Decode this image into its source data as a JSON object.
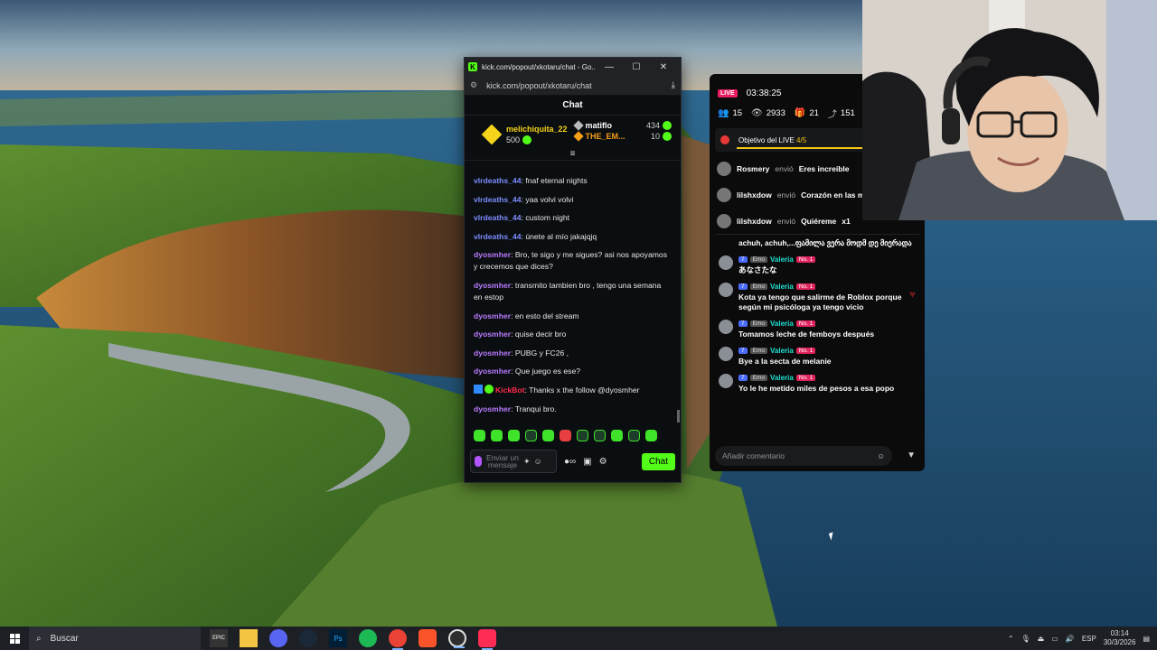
{
  "browser": {
    "window_title": "kick.com/popout/xkotaru/chat - Go...",
    "url": "kick.com/popout/xkotaru/chat",
    "chat_header": "Chat"
  },
  "kick_chat": {
    "pinned_top": {
      "name": "melichiquita_22",
      "value": "500"
    },
    "top_supporters": [
      {
        "name": "matiflo",
        "value": "434",
        "color": "#ffffff"
      },
      {
        "name": "THE_EM...",
        "value": "10",
        "color": "#f59e18"
      }
    ],
    "messages": [
      {
        "user": "vlrdeaths_44",
        "text": ": fnaf eternal nights",
        "color": "blue"
      },
      {
        "user": "vlrdeaths_44",
        "text": ": yaa volvi volvi",
        "color": "blue"
      },
      {
        "user": "vlrdeaths_44",
        "text": ": custom night",
        "color": "blue"
      },
      {
        "user": "vlrdeaths_44",
        "text": ": únete al mío jakajqjq",
        "color": "blue"
      },
      {
        "user": "dyosmher",
        "text": ": Bro, te sigo y me sigues? asi nos apoyamos y crecemos que dices?",
        "color": "purple"
      },
      {
        "user": "dyosmher",
        "text": ": transmito tambien bro , tengo una semana en estop",
        "color": "purple"
      },
      {
        "user": "dyosmher",
        "text": ": en esto del stream",
        "color": "purple"
      },
      {
        "user": "dyosmher",
        "text": ": quise decir bro",
        "color": "purple"
      },
      {
        "user": "dyosmher",
        "text": ": PUBG y FC26 ,",
        "color": "purple"
      },
      {
        "user": "dyosmher",
        "text": ": Que juego es ese?",
        "color": "purple"
      },
      {
        "user": "KickBot",
        "text": ": Thanks x the follow @dyosmher",
        "color": "bot"
      },
      {
        "user": "dyosmher",
        "text": ": Tranqui bro.",
        "color": "purple"
      }
    ],
    "composer_placeholder": "Enviar un mensaje",
    "send_label": "Chat"
  },
  "overlay": {
    "live_label": "LIVE",
    "timer": "03:38:25",
    "stats": [
      {
        "icon": "users-icon",
        "glyph": "👥",
        "value": "15"
      },
      {
        "icon": "eye-icon",
        "glyph": "👁",
        "value": "2933"
      },
      {
        "icon": "gift-icon",
        "glyph": "🎁",
        "value": "21"
      },
      {
        "icon": "share-icon",
        "glyph": "⤴",
        "value": "151"
      }
    ],
    "goal_label": "Objetivo del LIVE",
    "goal_progress": "4/5",
    "gifts": [
      {
        "user": "Rosmery",
        "action": "envió",
        "gift": "Eres increíble",
        "count": ""
      },
      {
        "user": "lilshxdow",
        "action": "envió",
        "gift": "Corazón en las m",
        "count": ""
      },
      {
        "user": "lilshxdow",
        "action": "envió",
        "gift": "Quiéreme",
        "count": "x1"
      }
    ],
    "first_comment": "achuh, achuh,...ფამილა ვერა მოდმ დე მიერადა",
    "comments": [
      {
        "level": "7",
        "emo": "Emo",
        "name": "Valeria",
        "rank": "No. 1",
        "text": "あなさたな"
      },
      {
        "level": "7",
        "emo": "Emo",
        "name": "Valeria",
        "rank": "No. 1",
        "text": "Kota ya tengo que salirme de Roblox porque según mi psicóloga ya tengo vicio"
      },
      {
        "level": "7",
        "emo": "Emo",
        "name": "Valeria",
        "rank": "No. 1",
        "text": "Tomamos leche de femboys después"
      },
      {
        "level": "7",
        "emo": "Emo",
        "name": "Valeria",
        "rank": "No. 1",
        "text": "Bye a la secta de melanie"
      },
      {
        "level": "7",
        "emo": "Emo",
        "name": "Valeria",
        "rank": "No. 1",
        "text": "Yo le he metido miles de pesos a esa popo"
      }
    ],
    "comment_placeholder": "Añadir comentario"
  },
  "taskbar": {
    "search_label": "Buscar",
    "apps": [
      "EPIC",
      "Explorer",
      "Discord",
      "Steam",
      "Ps",
      "Spotify",
      "Chrome",
      "Brave",
      "OBS",
      "TikTok"
    ],
    "language": "ESP",
    "time": "03:14",
    "date": "30/3/2026"
  }
}
